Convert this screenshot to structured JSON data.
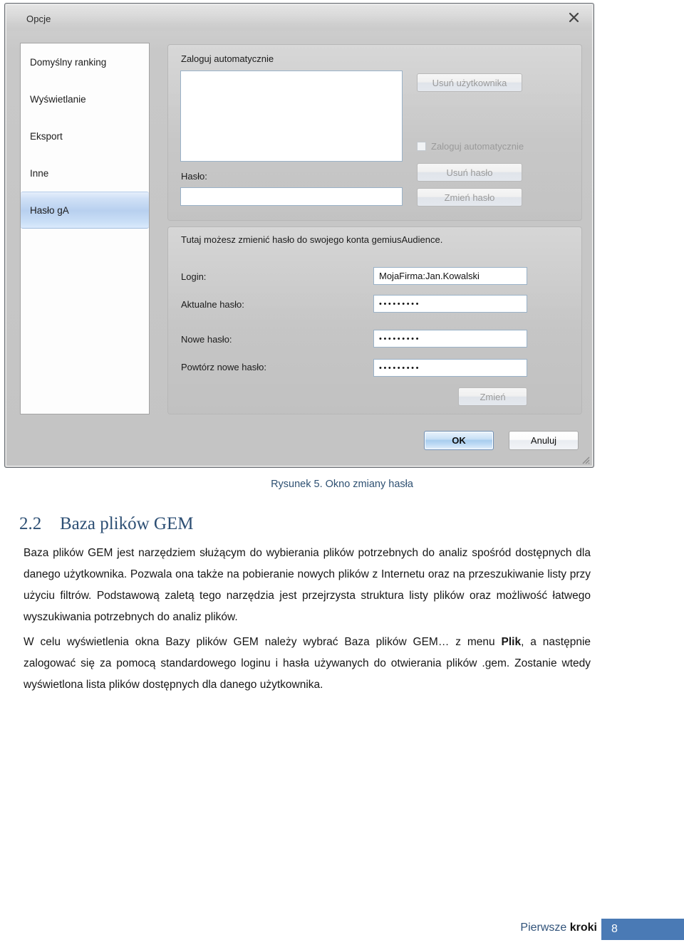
{
  "dialog": {
    "title": "Opcje",
    "close_icon": "close-icon",
    "sidebar": {
      "items": [
        {
          "label": "Domyślny ranking",
          "selected": false
        },
        {
          "label": "Wyświetlanie",
          "selected": false
        },
        {
          "label": "Eksport",
          "selected": false
        },
        {
          "label": "Inne",
          "selected": false
        },
        {
          "label": "Hasło gA",
          "selected": true
        }
      ]
    },
    "group_auto_login": {
      "title": "Zaloguj automatycznie",
      "user_list_value": "",
      "password_label": "Hasło:",
      "password_value": "",
      "delete_user_button": "Usuń użytkownika",
      "auto_login_checkbox_label": "Zaloguj automatycznie",
      "auto_login_checked": false,
      "delete_password_button": "Usuń hasło",
      "change_password_button": "Zmień hasło"
    },
    "group_change_password": {
      "description": "Tutaj możesz zmienić hasło do swojego konta gemiusAudience.",
      "login_label": "Login:",
      "login_value": "MojaFirma:Jan.Kowalski",
      "current_password_label": "Aktualne hasło:",
      "current_password_value": "•••••••••",
      "new_password_label": "Nowe hasło:",
      "new_password_value": "•••••••••",
      "repeat_password_label": "Powtórz nowe hasło:",
      "repeat_password_value": "•••••••••",
      "change_button": "Zmień"
    },
    "footer_buttons": {
      "ok": "OK",
      "cancel": "Anuluj"
    }
  },
  "document": {
    "figure_caption": "Rysunek 5. Okno zmiany hasła",
    "heading_number": "2.2",
    "heading_title": "Baza plików GEM",
    "paragraph_1_a": "Baza plików GEM jest narzędziem służącym do wybierania plików potrzebnych do analiz spośród dostępnych dla danego użytkownika. Pozwala ona także na pobieranie nowych plików z Internetu oraz na przeszukiwanie listy przy użyciu filtrów. Podstawową zaletą tego narzędzia jest przejrzysta struktura listy plików oraz możliwość łatwego wyszukiwania potrzebnych do analiz plików.",
    "paragraph_2_a": "W celu wyświetlenia okna Bazy plików GEM należy wybrać Baza plików GEM… z menu ",
    "paragraph_2_bold": "Plik",
    "paragraph_2_b": ", a następnie zalogować się za pomocą standardowego loginu i hasła używanych do otwierania plików .gem. Zostanie wtedy wyświetlona lista plików dostępnych dla danego użytkownika."
  },
  "footer": {
    "label_part1": "Pierwsze ",
    "label_part2": "kroki",
    "page_number": "8",
    "accent_color": "#4a7ab5"
  }
}
